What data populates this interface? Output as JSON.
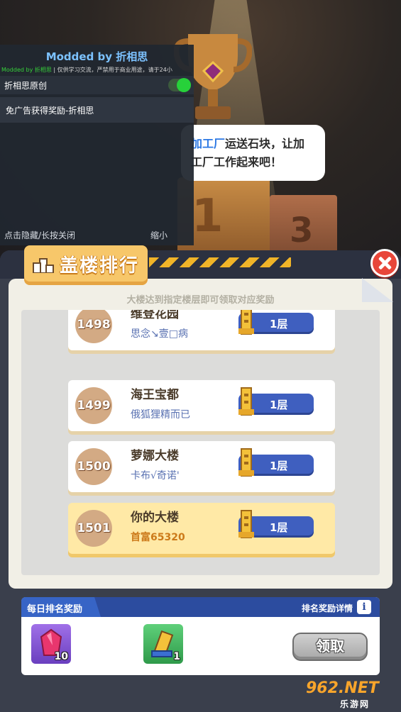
{
  "scene": {
    "bubble_hl": "加工厂",
    "bubble_rest1": "运送石块，让加",
    "bubble_line2": "工厂工作起来吧！",
    "podium_first": "1",
    "podium_third": "3"
  },
  "mod_menu": {
    "title": "Modded by 折相思",
    "subtitle_prefix": "Modded by 折相思",
    "subtitle_text": "| 仅供学习交流，严禁用于商业用途，请于24小",
    "toggle_label": "折相思原创",
    "toggle_on": true,
    "button_label": "免广告获得奖励-折相思",
    "footer_hide": "点击隐藏/长按关闭",
    "footer_minimize": "缩小"
  },
  "panel": {
    "title": "盖楼排行",
    "hint": "大楼达到指定楼层即可领取对应奖励"
  },
  "ranking": [
    {
      "rank": "1498",
      "name": "维登花园",
      "player": "思念↘壹□病",
      "floor": "1层"
    },
    {
      "rank": "1499",
      "name": "海王宝都",
      "player": "俄狐狸精而已",
      "floor": "1层"
    },
    {
      "rank": "1500",
      "name": "萝娜大楼",
      "player": "卡布√奇诺'",
      "floor": "1层"
    },
    {
      "rank": "1501",
      "name": "你的大楼",
      "player": "首富65320",
      "floor": "1层"
    }
  ],
  "daily": {
    "title": "每日排名奖励",
    "detail": "排名奖励详情",
    "info_icon": "i",
    "items": [
      {
        "icon": "gem-icon",
        "count": "10"
      },
      {
        "icon": "trophy-item-icon",
        "count": "1"
      }
    ],
    "claim": "领取"
  },
  "watermark": {
    "main": "962.NET",
    "sub": "乐游网"
  },
  "colors": {
    "accent_blue": "#3f5fbf",
    "close_red": "#e8463a",
    "tab_gold": "#f7c76a",
    "toggle_green": "#27d13a"
  }
}
